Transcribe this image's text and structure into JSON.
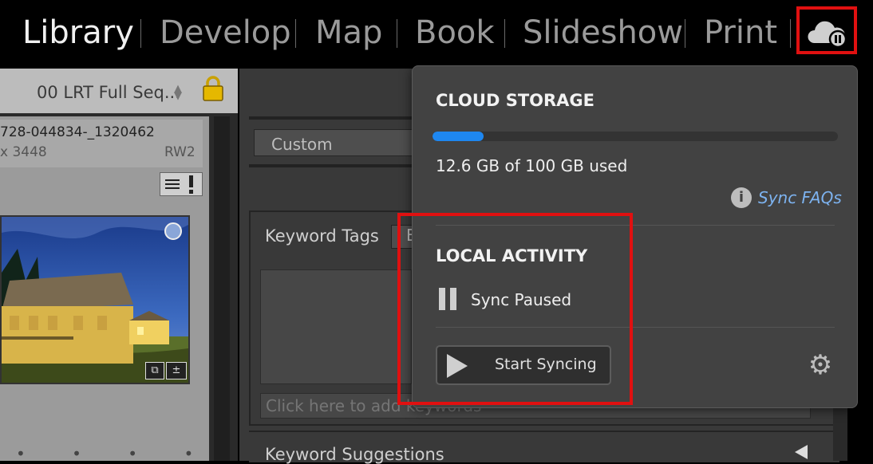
{
  "modules": [
    {
      "label": "Library",
      "active": true
    },
    {
      "label": "Develop",
      "active": false
    },
    {
      "label": "Map",
      "active": false
    },
    {
      "label": "Book",
      "active": false
    },
    {
      "label": "Slideshow",
      "active": false
    },
    {
      "label": "Print",
      "active": false
    }
  ],
  "cloud_button": {
    "icon": "cloud-paused-icon",
    "highlight_color": "#e01010"
  },
  "left_panel": {
    "collection": "00 LRT Full Seq...",
    "lock_icon": "lock-icon",
    "photo": {
      "filename": "728-044834-_1320462",
      "dimensions": "x 3448",
      "extension": "RW2"
    },
    "filmstrip_dots": "• • • • •"
  },
  "right_panel": {
    "preset_value": "Custom",
    "keyword_tags_label": "Keyword Tags",
    "keyword_select_value": "E",
    "keyword_input_placeholder": "Click here to add keywords",
    "keyword_suggestions_label": "Keyword Suggestions"
  },
  "cloud_popover": {
    "cloud_storage_title": "CLOUD STORAGE",
    "storage_used_fraction": 0.126,
    "storage_used_text": "12.6 GB of 100 GB used",
    "sync_faqs_label": "Sync FAQs",
    "local_activity_title": "LOCAL ACTIVITY",
    "sync_status": "Sync Paused",
    "start_syncing_label": "Start Syncing",
    "accent_color": "#1e87f0"
  }
}
